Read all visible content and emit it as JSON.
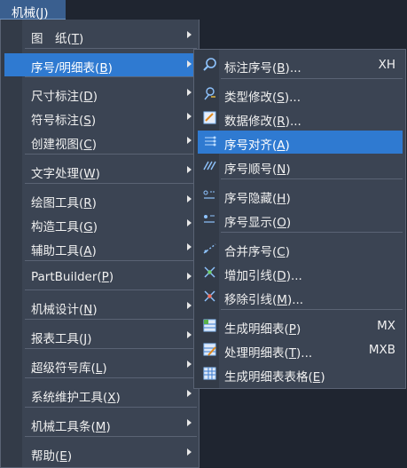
{
  "menubar": {
    "label": "机械(",
    "key": "J",
    "tail": ")"
  },
  "left_menu": [
    {
      "label": "图　纸(",
      "key": "T",
      "tail": ")",
      "active": false
    },
    {
      "label": "序号/明细表(",
      "key": "B",
      "tail": ")",
      "active": true
    },
    {
      "label": "尺寸标注(",
      "key": "D",
      "tail": ")",
      "active": false
    },
    {
      "label": "符号标注(",
      "key": "S",
      "tail": ")",
      "active": false
    },
    {
      "label": "创建视图(",
      "key": "C",
      "tail": ")",
      "active": false
    },
    {
      "label": "文字处理(",
      "key": "W",
      "tail": ")",
      "active": false
    },
    {
      "label": "绘图工具(",
      "key": "R",
      "tail": ")",
      "active": false
    },
    {
      "label": "构造工具(",
      "key": "G",
      "tail": ")",
      "active": false
    },
    {
      "label": "辅助工具(",
      "key": "A",
      "tail": ")",
      "active": false
    },
    {
      "label": "PartBuilder(",
      "key": "P",
      "tail": ")",
      "active": false
    },
    {
      "label": "机械设计(",
      "key": "N",
      "tail": ")",
      "active": false
    },
    {
      "label": "报表工具(",
      "key": "J",
      "tail": ")",
      "active": false
    },
    {
      "label": "超级符号库(",
      "key": "L",
      "tail": ")",
      "active": false
    },
    {
      "label": "系统维护工具(",
      "key": "X",
      "tail": ")",
      "active": false
    },
    {
      "label": "机械工具条(",
      "key": "M",
      "tail": ")",
      "active": false
    },
    {
      "label": "帮助(",
      "key": "E",
      "tail": ")",
      "active": false
    }
  ],
  "sub_menu": [
    {
      "label": "标注序号(",
      "key": "B",
      "tail": ")...",
      "shortcut": "XH",
      "icon": "magnifier-icon",
      "active": false
    },
    {
      "label": "类型修改(",
      "key": "S",
      "tail": ")...",
      "shortcut": "",
      "icon": "type-edit-icon",
      "active": false
    },
    {
      "label": "数据修改(",
      "key": "R",
      "tail": ")...",
      "shortcut": "",
      "icon": "data-edit-icon",
      "active": false
    },
    {
      "label": "序号对齐(",
      "key": "A",
      "tail": ")",
      "shortcut": "",
      "icon": "align-icon",
      "active": true
    },
    {
      "label": "序号顺号(",
      "key": "N",
      "tail": ")",
      "shortcut": "",
      "icon": "sequence-icon",
      "active": false
    },
    {
      "label": "序号隐藏(",
      "key": "H",
      "tail": ")",
      "shortcut": "",
      "icon": "hide-icon",
      "active": false
    },
    {
      "label": "序号显示(",
      "key": "O",
      "tail": ")",
      "shortcut": "",
      "icon": "show-icon",
      "active": false
    },
    {
      "label": "合并序号(",
      "key": "C",
      "tail": ")",
      "shortcut": "",
      "icon": "merge-icon",
      "active": false
    },
    {
      "label": "增加引线(",
      "key": "D",
      "tail": ")...",
      "shortcut": "",
      "icon": "add-leader-icon",
      "active": false
    },
    {
      "label": "移除引线(",
      "key": "M",
      "tail": ")...",
      "shortcut": "",
      "icon": "remove-leader-icon",
      "active": false
    },
    {
      "label": "生成明细表(",
      "key": "P",
      "tail": ")",
      "shortcut": "MX",
      "icon": "bom-create-icon",
      "active": false
    },
    {
      "label": "处理明细表(",
      "key": "T",
      "tail": ")...",
      "shortcut": "MXB",
      "icon": "bom-edit-icon",
      "active": false
    },
    {
      "label": "生成明细表表格(",
      "key": "E",
      "tail": ")",
      "shortcut": "",
      "icon": "bom-table-icon",
      "active": false
    }
  ]
}
